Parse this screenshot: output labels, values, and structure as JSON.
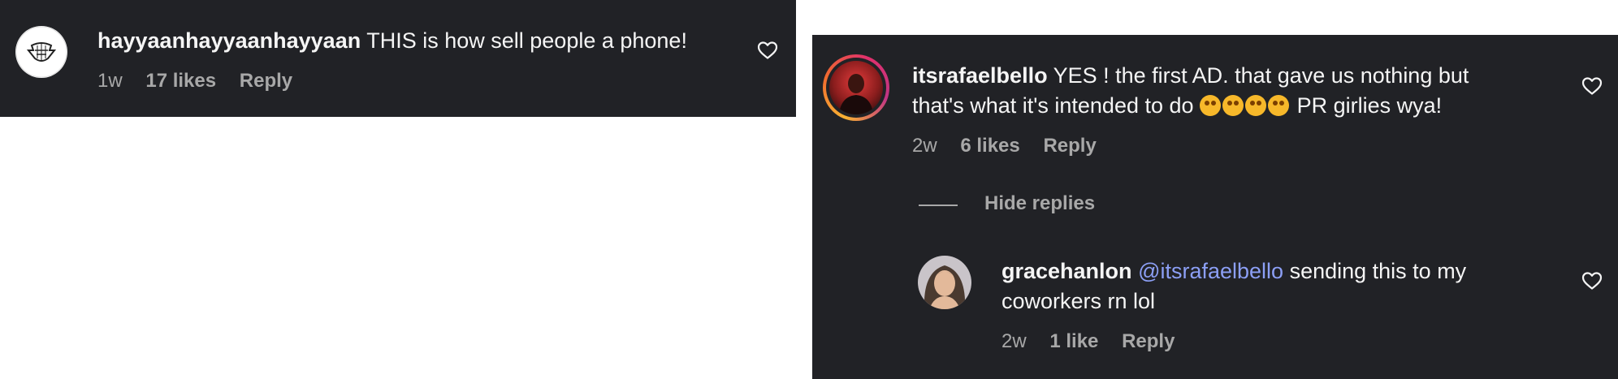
{
  "comments": [
    {
      "username": "hayyaanhayyaanhayyaan",
      "text": "THIS is how sell people a phone!",
      "time": "1w",
      "likes": "17 likes",
      "reply": "Reply"
    },
    {
      "username": "itsrafaelbello",
      "text_line1": "YES ! the first AD. that gave us nothing but",
      "text_line2_pre": "that's what it's intended to do",
      "text_line2_post": "PR girlies wya!",
      "emoji_icon": "star-struck-emoji",
      "emoji_count": 4,
      "time": "2w",
      "likes": "6 likes",
      "reply": "Reply",
      "hide_replies": "Hide replies"
    },
    {
      "username": "gracehanlon",
      "mention": "@itsrafaelbello",
      "text_line1": "sending this to my",
      "text_line2": "coworkers rn lol",
      "time": "2w",
      "likes": "1 like",
      "reply": "Reply"
    }
  ],
  "colors": {
    "panel_bg": "#212226",
    "text": "#f5f5f5",
    "muted": "#a8a8a8",
    "mention": "#8c9ff5"
  }
}
